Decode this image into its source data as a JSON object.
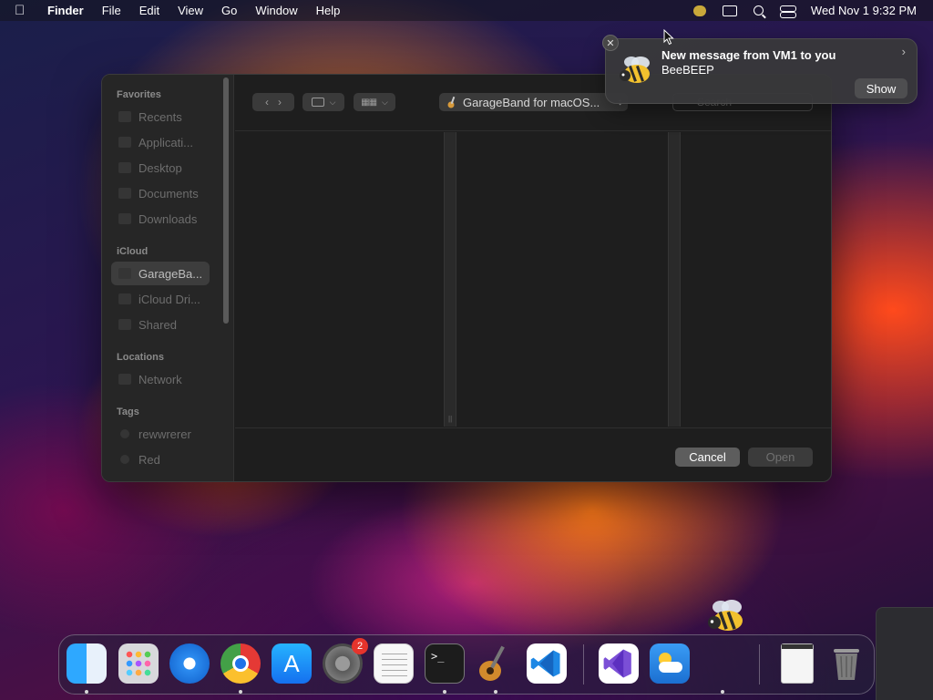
{
  "menubar": {
    "app_name": "Finder",
    "items": [
      "File",
      "Edit",
      "View",
      "Go",
      "Window",
      "Help"
    ],
    "clock": "Wed Nov 1  9:32 PM",
    "icons": [
      "apple-icon",
      "beebeep-icon",
      "screen-mirroring-icon",
      "search-icon",
      "control-center-icon"
    ]
  },
  "dialog": {
    "sidebar": {
      "sections": {
        "favorites": "Favorites",
        "icloud": "iCloud",
        "locations": "Locations",
        "tags": "Tags"
      },
      "favorites": [
        "Recents",
        "Applicati...",
        "Desktop",
        "Documents",
        "Downloads"
      ],
      "icloud": [
        "GarageBa...",
        "iCloud Dri...",
        "Shared"
      ],
      "locations": [
        "Network"
      ],
      "tags": [
        "rewwrerer",
        "Red"
      ],
      "selected": "GarageBa..."
    },
    "toolbar": {
      "path_label": "GarageBand for macOS...",
      "search_placeholder": "Search"
    },
    "buttons": {
      "cancel": "Cancel",
      "open": "Open"
    }
  },
  "notification": {
    "title": "New message from VM1 to you",
    "subtitle": "BeeBEEP",
    "action": "Show"
  },
  "dock": {
    "apps": [
      "Finder",
      "Launchpad",
      "Safari",
      "Chrome",
      "App Store",
      "System Settings",
      "TextEdit",
      "Terminal",
      "GarageBand",
      "Visual Studio Code",
      "Visual Studio",
      "Weather",
      "Preview",
      "Trash"
    ],
    "settings_badge": "2"
  },
  "colors": {
    "accent_blue": "#1e73e8",
    "badge_red": "#e5342c"
  }
}
